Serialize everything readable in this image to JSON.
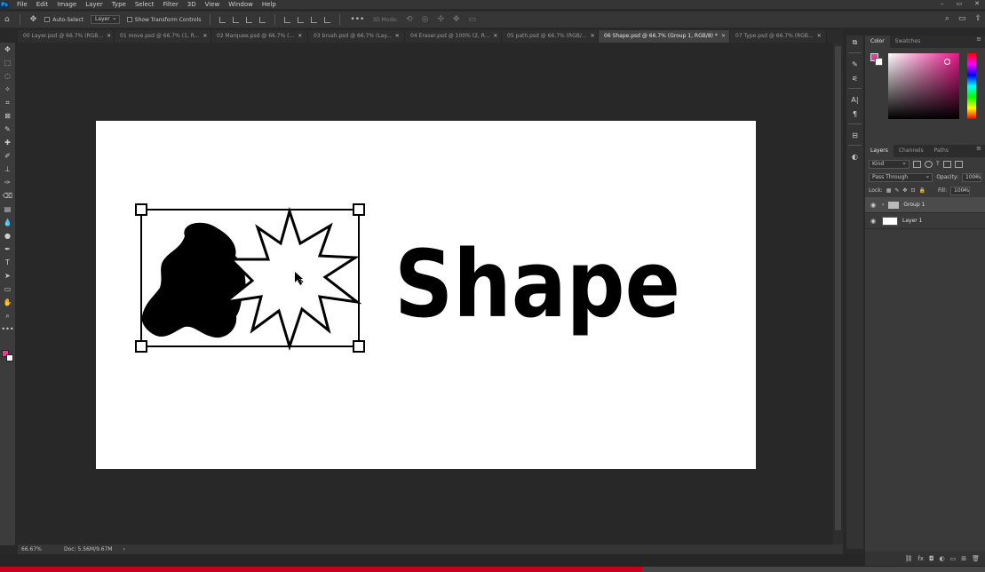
{
  "menubar": {
    "logo": "Ps",
    "items": [
      "File",
      "Edit",
      "Image",
      "Layer",
      "Type",
      "Select",
      "Filter",
      "3D",
      "View",
      "Window",
      "Help"
    ],
    "window_controls": [
      "–",
      "▭",
      "✕"
    ]
  },
  "options_bar": {
    "auto_select_label": "Auto-Select",
    "auto_select_target": "Layer",
    "show_transform_label": "Show Transform Controls",
    "mode_3d_label": "3D Mode:",
    "more_label": "•••"
  },
  "tabs": [
    {
      "label": "00 Layer.psd @ 66.7% (RGB...",
      "close": "✕",
      "active": false
    },
    {
      "label": "01 move.psd @ 66.7% (1, R...",
      "close": "✕",
      "active": false
    },
    {
      "label": "02 Marquee.psd @ 66.7% (...",
      "close": "✕",
      "active": false
    },
    {
      "label": "03 brush.psd @ 66.7% (Lay...",
      "close": "✕",
      "active": false
    },
    {
      "label": "04 Eraser.psd @ 100% (2, R...",
      "close": "✕",
      "active": false
    },
    {
      "label": "05 path.psd @ 66.7% (RGB/...",
      "close": "✕",
      "active": false
    },
    {
      "label": "06 Shape.psd @ 66.7% (Group 1, RGB/8) *",
      "close": "✕",
      "active": true
    },
    {
      "label": "07 Type.psd @ 66.7% (RGB...",
      "close": "✕",
      "active": false
    }
  ],
  "canvas": {
    "text": "Shape",
    "colors": {
      "background": "#ffffff",
      "ink": "#000000"
    }
  },
  "status_bar": {
    "zoom": "66.67%",
    "doc_info": "Doc: 5.56M/9.67M",
    "arrow": "›"
  },
  "color_panel": {
    "tabs": [
      "Color",
      "Swatches"
    ],
    "foreground": "#e0409a",
    "background": "#ffffff"
  },
  "layers_panel": {
    "tabs": [
      "Layers",
      "Channels",
      "Paths"
    ],
    "kind_filter": "Kind",
    "blend_mode": "Pass Through",
    "opacity_label": "Opacity:",
    "opacity_value": "100%",
    "lock_label": "Lock:",
    "fill_label": "Fill:",
    "fill_value": "100%",
    "layers": [
      {
        "name": "Group 1",
        "type": "group",
        "selected": true
      },
      {
        "name": "Layer 1",
        "type": "pixel",
        "selected": false
      }
    ],
    "footer_icons": [
      "link-icon",
      "fx-icon",
      "mask-icon",
      "adjustment-icon",
      "folder-icon",
      "new-layer-icon",
      "trash-icon"
    ]
  },
  "progress": {
    "fraction": 0.652,
    "color": "#c8001b"
  }
}
